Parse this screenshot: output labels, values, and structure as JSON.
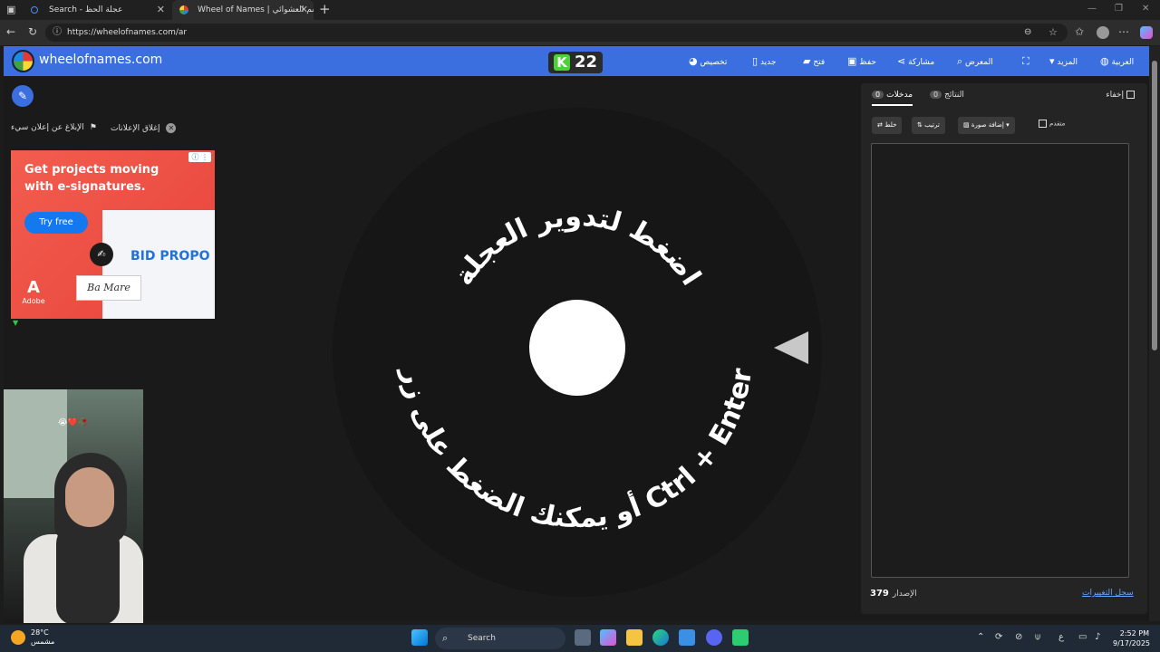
{
  "browser": {
    "tabs": [
      {
        "label": "Search - عجلة الحظ"
      },
      {
        "label": "Wheel of Names | الاسم العشوائي"
      }
    ],
    "new_tab": "+",
    "url": "https://wheelofnames.com/ar"
  },
  "site": {
    "brand": "wheelofnames.com",
    "k_count": "22",
    "k_letter": "K",
    "menu": {
      "customize": "تخصيص",
      "new": "جديد",
      "open": "فتح",
      "save": "حفظ",
      "share": "مشاركة",
      "gallery": "المعرض",
      "more": "المزيد",
      "language": "العربية"
    }
  },
  "ads": {
    "close_ads": "إغلاق الإعلانات",
    "report_ad": "الإبلاغ عن إعلان سيء",
    "headline": "Get projects moving with e-signatures.",
    "button": "Try free",
    "brand_text": "BID PROPO",
    "adobe": "Adobe",
    "adobe_letter": "A",
    "signature": "Ba Mare"
  },
  "webcam": {
    "emoji": "😭❤️🥀"
  },
  "wheel": {
    "text_top": "اضغط لتدوير العجلة",
    "text_bottom": "أو يمكنك الضغط على زر Ctrl + Enter"
  },
  "panel": {
    "entries_tab": "مدخلات",
    "entries_count": "0",
    "results_tab": "النتائج",
    "results_count": "0",
    "hide": "إخفاء",
    "shuffle": "خلط",
    "sort": "ترتيب",
    "add_image": "إضافة صورة",
    "advanced": "متقدم",
    "version_label": "الإصدار",
    "version": "379",
    "changelog": "سجل التغييرات"
  },
  "taskbar": {
    "temp": "28°C",
    "weather": "مشمس",
    "search": "Search",
    "time": "2:52 PM",
    "date": "9/17/2025",
    "lang": "ع"
  },
  "colors": {
    "accent": "#3b6fe0",
    "background": "#1a1a1a",
    "panel": "#242424"
  }
}
